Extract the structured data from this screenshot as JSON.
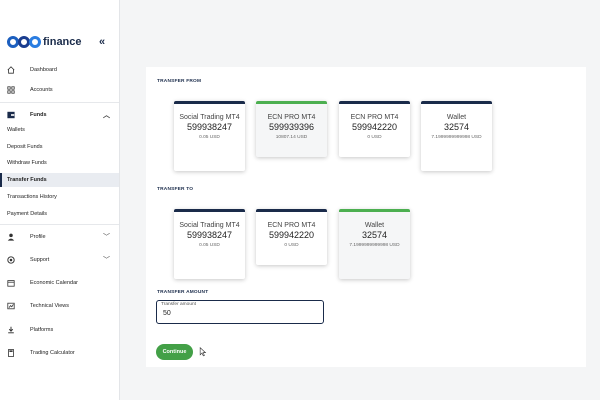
{
  "brand": {
    "name": "finance"
  },
  "sidebar": {
    "collapse_icon": "«",
    "items": [
      {
        "label": "Dashboard",
        "icon": "home-icon"
      },
      {
        "label": "Accounts",
        "icon": "grid-icon"
      },
      {
        "label": "Funds",
        "icon": "wallet-icon",
        "expanded": true
      },
      {
        "label": "Profile",
        "icon": "user-icon"
      },
      {
        "label": "Support",
        "icon": "support-icon"
      },
      {
        "label": "Economic Calendar",
        "icon": "calendar-icon"
      },
      {
        "label": "Technical Views",
        "icon": "chart-icon"
      },
      {
        "label": "Platforms",
        "icon": "download-icon"
      },
      {
        "label": "Trading Calculator",
        "icon": "calculator-icon"
      }
    ],
    "funds_sub": [
      {
        "label": "Wallets"
      },
      {
        "label": "Deposit Funds"
      },
      {
        "label": "Withdraw Funds"
      },
      {
        "label": "Transfer Funds",
        "active": true
      },
      {
        "label": "Transactions History"
      },
      {
        "label": "Payment Details"
      }
    ]
  },
  "transfer": {
    "from_title": "TRANSFER FROM",
    "to_title": "TRANSFER TO",
    "amount_title": "TRANSFER AMOUNT",
    "amount_label": "Transfer amount",
    "amount_value": "50",
    "continue_label": "Continue",
    "from_accounts": [
      {
        "name": "Social Trading MT4",
        "number": "599938247",
        "balance": "0.05 USD",
        "selected": false
      },
      {
        "name": "ECN PRO MT4",
        "number": "599939396",
        "balance": "10807.14 USD",
        "selected": true
      },
      {
        "name": "ECN PRO MT4",
        "number": "599942220",
        "balance": "0 USD",
        "selected": false
      },
      {
        "name": "Wallet",
        "number": "32574",
        "balance": "7.1999999999998 USD",
        "selected": false
      }
    ],
    "to_accounts": [
      {
        "name": "Social Trading MT4",
        "number": "599938247",
        "balance": "0.05 USD",
        "selected": false
      },
      {
        "name": "ECN PRO MT4",
        "number": "599942220",
        "balance": "0 USD",
        "selected": false
      },
      {
        "name": "Wallet",
        "number": "32574",
        "balance": "7.1999999999998 USD",
        "selected": true
      }
    ]
  },
  "colors": {
    "accent": "#1a2b4a",
    "selected": "#4caf50",
    "button": "#43a047",
    "brand": "#1c5fbf"
  }
}
